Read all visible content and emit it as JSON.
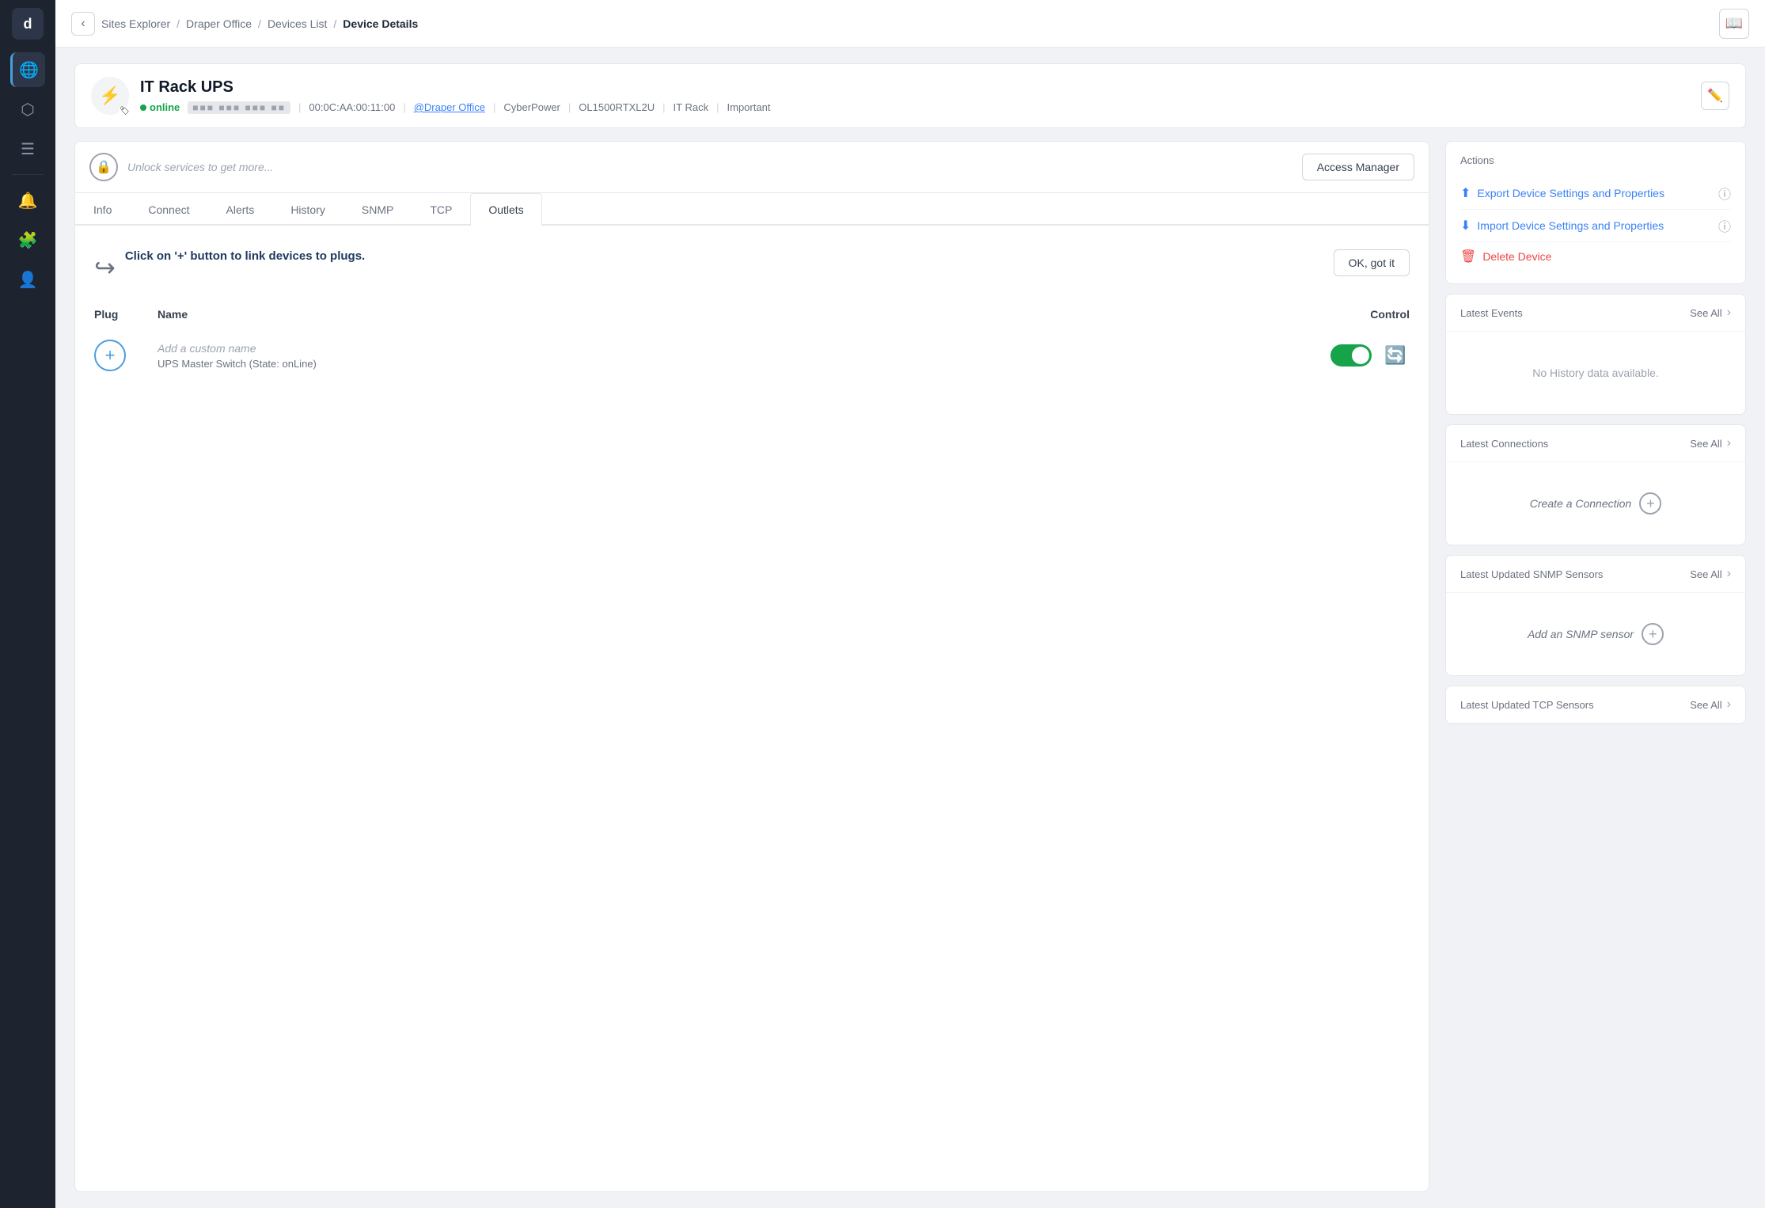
{
  "sidebar": {
    "logo": "d",
    "items": [
      {
        "id": "globe",
        "icon": "🌐",
        "active": true
      },
      {
        "id": "cube",
        "icon": "⬡"
      },
      {
        "id": "list",
        "icon": "☰"
      },
      {
        "id": "bell",
        "icon": "🔔"
      },
      {
        "id": "puzzle",
        "icon": "🧩"
      },
      {
        "id": "user",
        "icon": "👤"
      }
    ]
  },
  "topbar": {
    "back_label": "‹",
    "breadcrumbs": [
      "Sites Explorer",
      "Draper Office",
      "Devices List",
      "Device Details"
    ],
    "book_icon": "📖"
  },
  "device": {
    "name": "IT Rack UPS",
    "status": "online",
    "ip_masked": "■■■ ■■■ ■■■ ■■",
    "mac": "00:0C:AA:00:11:00",
    "site_link": "@Draper Office",
    "manufacturer": "CyberPower",
    "model": "OL1500RTXL2U",
    "category": "IT Rack",
    "importance": "Important"
  },
  "lock_banner": {
    "placeholder_text": "Unlock services to get more...",
    "access_manager_label": "Access Manager"
  },
  "tabs": [
    {
      "id": "info",
      "label": "Info"
    },
    {
      "id": "connect",
      "label": "Connect"
    },
    {
      "id": "alerts",
      "label": "Alerts"
    },
    {
      "id": "history",
      "label": "History"
    },
    {
      "id": "snmp",
      "label": "SNMP"
    },
    {
      "id": "tcp",
      "label": "TCP"
    },
    {
      "id": "outlets",
      "label": "Outlets",
      "active": true
    }
  ],
  "outlets_content": {
    "hint_text": "Click on '+' button to link devices to plugs.",
    "hint_ok_label": "OK, got it",
    "columns": {
      "plug": "Plug",
      "name": "Name",
      "control": "Control"
    },
    "outlet_row": {
      "custom_name_placeholder": "Add a custom name",
      "state_text": "UPS Master Switch (State: onLine)"
    }
  },
  "actions": {
    "title": "Actions",
    "export_label": "Export Device Settings and Properties",
    "import_label": "Import Device Settings and Properties",
    "delete_label": "Delete Device"
  },
  "latest_events": {
    "title": "Latest Events",
    "see_all_label": "See All",
    "empty_text": "No History data available."
  },
  "latest_connections": {
    "title": "Latest Connections",
    "see_all_label": "See All",
    "create_label": "Create a Connection"
  },
  "latest_snmp": {
    "title": "Latest Updated SNMP Sensors",
    "see_all_label": "See All",
    "add_label": "Add an SNMP sensor"
  },
  "latest_tcp": {
    "title": "Latest Updated TCP Sensors",
    "see_all_label": "See All"
  }
}
